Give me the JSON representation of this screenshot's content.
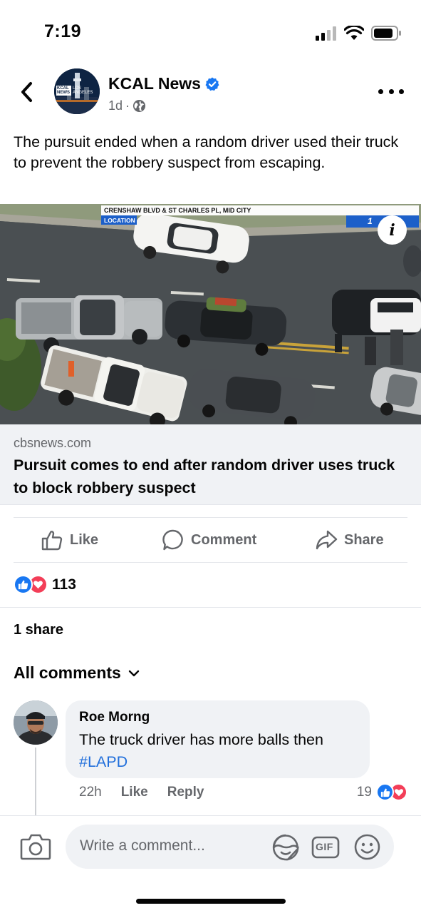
{
  "status_bar": {
    "time": "7:19"
  },
  "post": {
    "page_name": "KCAL News",
    "avatar_text_1": "KCAL",
    "avatar_text_2": "NEWS",
    "avatar_text_3": "LOS",
    "avatar_text_4": "ANGELES",
    "time_ago": "1d",
    "separator": "·",
    "text": "The pursuit ended when a random driver used their truck to prevent the robbery suspect from escaping."
  },
  "link_preview": {
    "overlay_location": "CRENSHAW BLVD & ST CHARLES PL, MID CITY",
    "overlay_tag": "LOCATION",
    "overlay_channel": "1",
    "domain": "cbsnews.com",
    "title": "Pursuit comes to end after random driver uses truck to block robbery suspect"
  },
  "actions": {
    "like": "Like",
    "comment": "Comment",
    "share": "Share"
  },
  "reactions": {
    "count": "113"
  },
  "shares": {
    "label": "1 share"
  },
  "comments_section": {
    "filter_label": "All comments",
    "comment": {
      "author": "Roe Morng",
      "text": "The truck driver has more balls then",
      "tag": "#LAPD",
      "time": "22h",
      "like": "Like",
      "reply": "Reply",
      "reaction_count": "19"
    }
  },
  "composer": {
    "placeholder": "Write a comment...",
    "gif_label": "GIF"
  },
  "colors": {
    "facebook_blue": "#1877f2",
    "love_red": "#f33e58",
    "secondary_text": "#65676b",
    "hashtag_blue": "#216fdb"
  }
}
